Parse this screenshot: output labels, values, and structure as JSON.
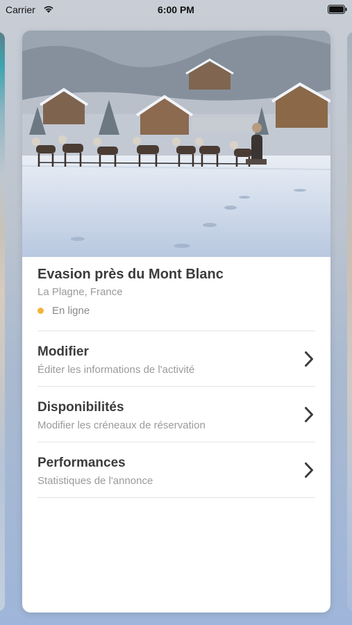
{
  "status_bar": {
    "carrier": "Carrier",
    "time": "6:00 PM"
  },
  "activity": {
    "title": "Evasion près du Mont Blanc",
    "location": "La Plagne, France",
    "status": "En ligne",
    "status_color": "#f3b33d"
  },
  "menu": [
    {
      "title": "Modifier",
      "subtitle": "Éditer les informations de l'activité",
      "icon": "chevron-right-icon"
    },
    {
      "title": "Disponibilités",
      "subtitle": "Modifier les créneaux de réservation",
      "icon": "chevron-right-icon"
    },
    {
      "title": "Performances",
      "subtitle": "Statistiques de l'annonce",
      "icon": "chevron-right-icon"
    }
  ]
}
